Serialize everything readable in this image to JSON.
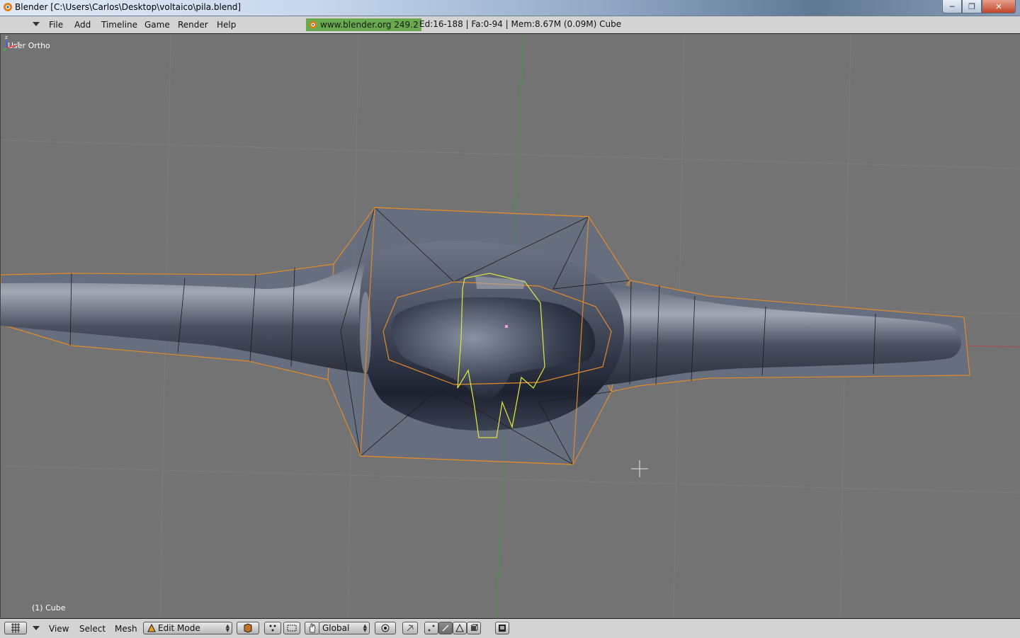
{
  "window": {
    "title": "Blender [C:\\Users\\Carlos\\Desktop\\voltaico\\pila.blend]",
    "buttons": {
      "minimize": "─",
      "maximize": "❐",
      "close": "✕"
    }
  },
  "menubar": {
    "items": [
      "File",
      "Add",
      "Timeline",
      "Game",
      "Render",
      "Help"
    ],
    "site": "www.blender.org 249.2",
    "stats": "Ed:16-188 | Fa:0-94 | Mem:8.67M (0.09M) Cube"
  },
  "viewport": {
    "view_name": "User Ortho",
    "object_label": "(1) Cube",
    "axis_labels": {
      "x": "x",
      "z": "z"
    }
  },
  "header": {
    "menus": [
      "View",
      "Select",
      "Mesh"
    ],
    "mode": "Edit Mode",
    "orientation": "Global",
    "icons": [
      "grid-icon",
      "mesh-icon",
      "pivot-icon",
      "manipulator-icon",
      "hand-icon",
      "proportional-icon",
      "snap-icon",
      "vertex-select-icon",
      "edge-select-icon",
      "face-select-icon",
      "occlude-icon",
      "render-icon"
    ]
  },
  "colors": {
    "viewport_bg": "#737373",
    "cage_edge": "#e08a2a",
    "selected_edge": "#d8e040",
    "mesh_fill": "#5a6478",
    "badge": "#6aa84f"
  }
}
